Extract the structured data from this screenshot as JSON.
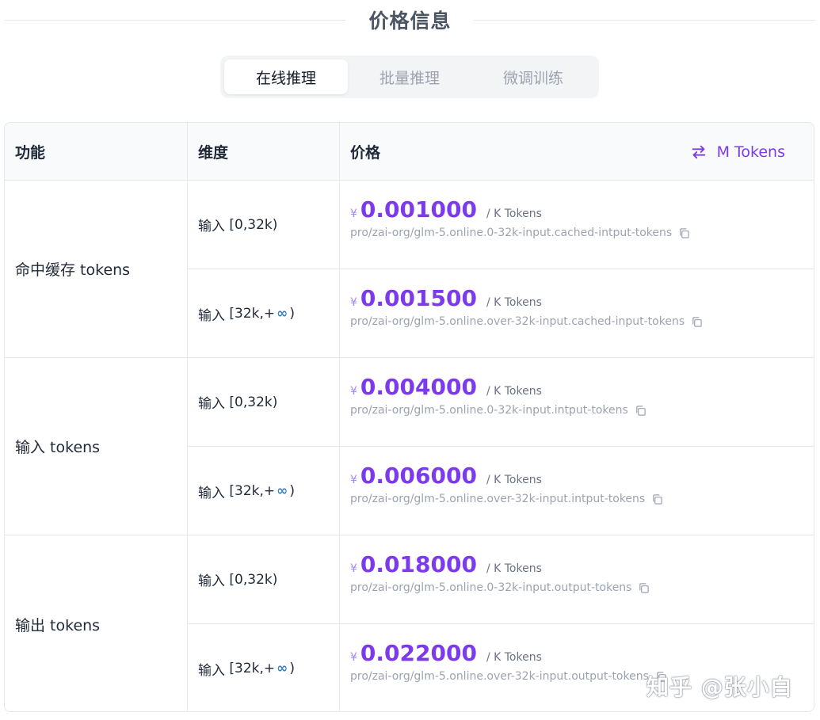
{
  "section": {
    "title": "价格信息"
  },
  "tabs": [
    {
      "label": "在线推理",
      "active": true
    },
    {
      "label": "批量推理",
      "active": false
    },
    {
      "label": "微调训练",
      "active": false
    }
  ],
  "table": {
    "headers": {
      "feature": "功能",
      "dimension": "维度",
      "price": "价格"
    },
    "unit_toggle_label": "M Tokens",
    "dim_prefix": "输入",
    "dim_range_low": "[0,32k)",
    "dim_range_high_open": "[32k,+",
    "dim_range_high_close": ")",
    "infinity_symbol": "∞",
    "currency_symbol": "¥",
    "per_unit": "/ K Tokens",
    "groups": [
      {
        "feature": "命中缓存 tokens",
        "rows": [
          {
            "price": "0.001000",
            "model": "pro/zai-org/glm-5.online.0-32k-input.cached-intput-tokens"
          },
          {
            "price": "0.001500",
            "model": "pro/zai-org/glm-5.online.over-32k-input.cached-input-tokens"
          }
        ]
      },
      {
        "feature": "输入 tokens",
        "rows": [
          {
            "price": "0.004000",
            "model": "pro/zai-org/glm-5.online.0-32k-input.intput-tokens"
          },
          {
            "price": "0.006000",
            "model": "pro/zai-org/glm-5.online.over-32k-input.intput-tokens"
          }
        ]
      },
      {
        "feature": "输出 tokens",
        "rows": [
          {
            "price": "0.018000",
            "model": "pro/zai-org/glm-5.online.0-32k-input.output-tokens"
          },
          {
            "price": "0.022000",
            "model": "pro/zai-org/glm-5.online.over-32k-input.output-tokens"
          }
        ]
      }
    ]
  },
  "watermark": "知乎 @张小白",
  "colors": {
    "accent": "#7c3aed",
    "infinity": "#3b82c4",
    "border": "#e5e7eb"
  }
}
